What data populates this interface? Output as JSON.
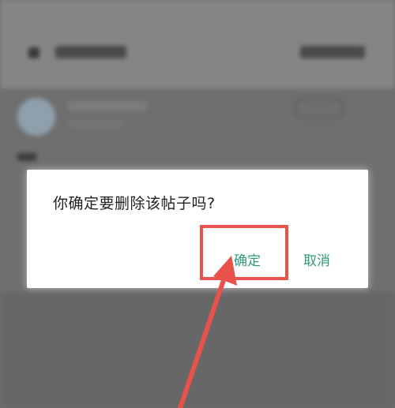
{
  "dialog": {
    "message": "你确定要删除该帖子吗?",
    "confirm_label": "确定",
    "cancel_label": "取消"
  },
  "colors": {
    "button_text": "#2f9a76",
    "annotation": "#e8524a",
    "overlay": "#6f6f6f"
  }
}
